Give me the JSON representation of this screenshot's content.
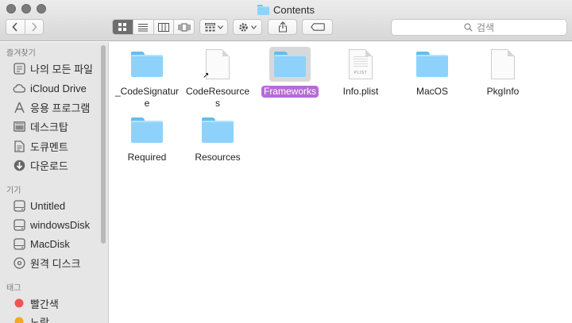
{
  "window": {
    "title": "Contents"
  },
  "toolbar": {
    "back_icon": "chevron-left-icon",
    "forward_icon": "chevron-right-icon",
    "views": [
      "icon-view",
      "list-view",
      "column-view",
      "cover-flow-view"
    ],
    "arrange_icon": "arrange-grid-icon",
    "action_icon": "gear-icon",
    "share_icon": "share-icon",
    "tag_icon": "tag-icon",
    "search_placeholder": "검색"
  },
  "sidebar": {
    "favorites_header": "즐겨찾기",
    "favorites": [
      {
        "label": "나의 모든 파일",
        "icon": "all-files-icon"
      },
      {
        "label": "iCloud Drive",
        "icon": "cloud-icon"
      },
      {
        "label": "응용 프로그램",
        "icon": "applications-icon"
      },
      {
        "label": "데스크탑",
        "icon": "desktop-icon"
      },
      {
        "label": "도큐멘트",
        "icon": "document-icon"
      },
      {
        "label": "다운로드",
        "icon": "download-icon"
      }
    ],
    "devices_header": "기기",
    "devices": [
      {
        "label": "Untitled",
        "icon": "disk-icon"
      },
      {
        "label": "windowsDisk",
        "icon": "disk-icon"
      },
      {
        "label": "MacDisk",
        "icon": "disk-icon"
      },
      {
        "label": "원격 디스크",
        "icon": "optical-disc-icon"
      }
    ],
    "tags_header": "태그",
    "tags": [
      {
        "label": "빨간색",
        "color": "#f05454"
      },
      {
        "label": "노랑",
        "color": "#f5a623"
      }
    ]
  },
  "files": [
    {
      "name": "_CodeSignature",
      "type": "folder",
      "selected": false
    },
    {
      "name": "CodeResources",
      "type": "alias",
      "selected": false
    },
    {
      "name": "Frameworks",
      "type": "folder",
      "selected": true
    },
    {
      "name": "Info.plist",
      "type": "plist",
      "tag_text": "PLIST",
      "selected": false
    },
    {
      "name": "MacOS",
      "type": "folder",
      "selected": false
    },
    {
      "name": "PkgInfo",
      "type": "document",
      "selected": false
    },
    {
      "name": "Required",
      "type": "folder",
      "selected": false
    },
    {
      "name": "Resources",
      "type": "folder",
      "selected": false
    }
  ],
  "colors": {
    "selection_label": "#b66bd6",
    "folder": "#8ed2fb"
  }
}
